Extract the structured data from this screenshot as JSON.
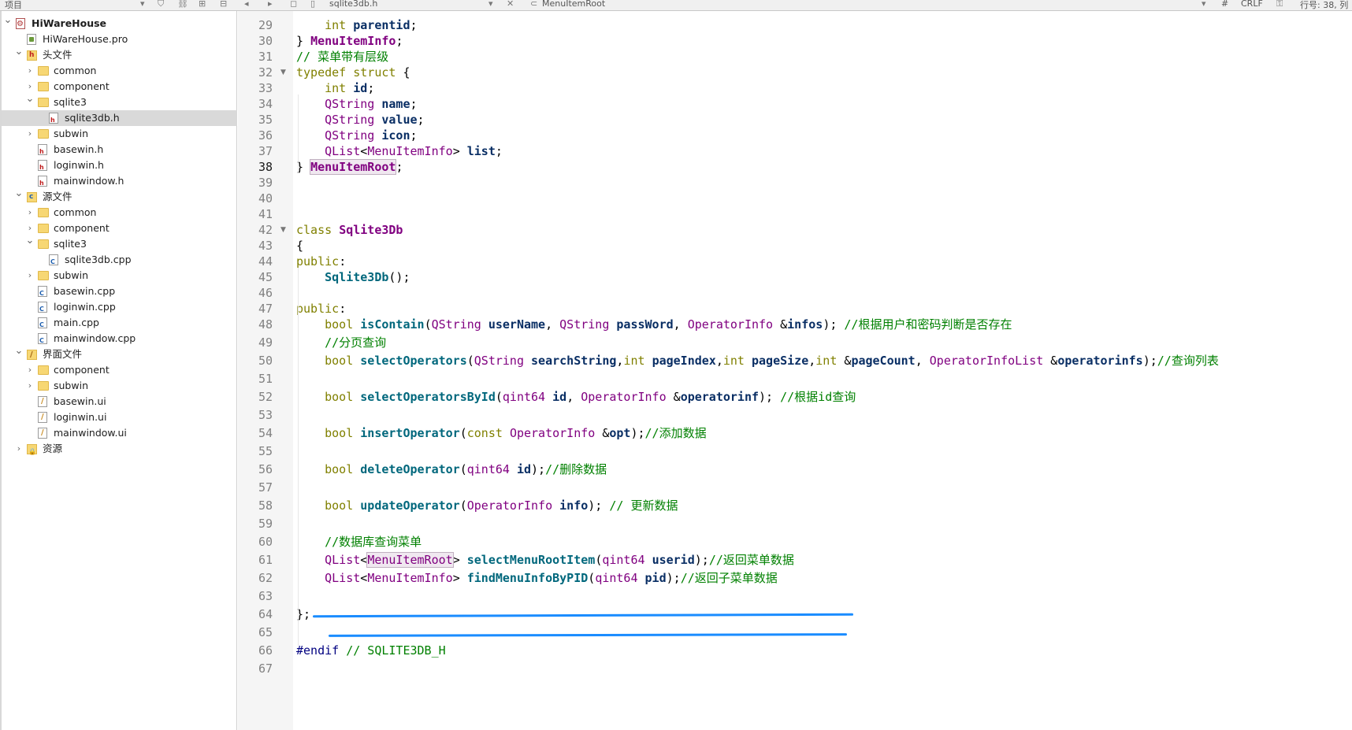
{
  "topbar": {
    "project_label": "项目",
    "file_tab": "sqlite3db.h",
    "symbol": "MenuItemRoot",
    "hash": "#",
    "line_ending": "CRLF",
    "position": "行号: 38, 列"
  },
  "tree": [
    {
      "label": "HiWareHouse",
      "icon": "project-icon",
      "level": 0,
      "arrow": "v",
      "bold": true
    },
    {
      "label": "HiWareHouse.pro",
      "icon": "pro-file-icon",
      "level": 1,
      "arrow": ""
    },
    {
      "label": "头文件",
      "icon": "headers-folder-icon",
      "level": 1,
      "arrow": "v"
    },
    {
      "label": "common",
      "icon": "folder-icon",
      "level": 2,
      "arrow": ">"
    },
    {
      "label": "component",
      "icon": "folder-icon",
      "level": 2,
      "arrow": ">"
    },
    {
      "label": "sqlite3",
      "icon": "folder-icon",
      "level": 2,
      "arrow": "v"
    },
    {
      "label": "sqlite3db.h",
      "icon": "header-file-icon",
      "level": 3,
      "arrow": "",
      "selected": true
    },
    {
      "label": "subwin",
      "icon": "folder-icon",
      "level": 2,
      "arrow": ">"
    },
    {
      "label": "basewin.h",
      "icon": "header-file-icon",
      "level": 2,
      "arrow": ""
    },
    {
      "label": "loginwin.h",
      "icon": "header-file-icon",
      "level": 2,
      "arrow": ""
    },
    {
      "label": "mainwindow.h",
      "icon": "header-file-icon",
      "level": 2,
      "arrow": ""
    },
    {
      "label": "源文件",
      "icon": "sources-folder-icon",
      "level": 1,
      "arrow": "v"
    },
    {
      "label": "common",
      "icon": "folder-icon",
      "level": 2,
      "arrow": ">"
    },
    {
      "label": "component",
      "icon": "folder-icon",
      "level": 2,
      "arrow": ">"
    },
    {
      "label": "sqlite3",
      "icon": "folder-icon",
      "level": 2,
      "arrow": "v"
    },
    {
      "label": "sqlite3db.cpp",
      "icon": "cpp-file-icon",
      "level": 3,
      "arrow": ""
    },
    {
      "label": "subwin",
      "icon": "folder-icon",
      "level": 2,
      "arrow": ">"
    },
    {
      "label": "basewin.cpp",
      "icon": "cpp-file-icon",
      "level": 2,
      "arrow": ""
    },
    {
      "label": "loginwin.cpp",
      "icon": "cpp-file-icon",
      "level": 2,
      "arrow": ""
    },
    {
      "label": "main.cpp",
      "icon": "cpp-file-icon",
      "level": 2,
      "arrow": ""
    },
    {
      "label": "mainwindow.cpp",
      "icon": "cpp-file-icon",
      "level": 2,
      "arrow": ""
    },
    {
      "label": "界面文件",
      "icon": "forms-folder-icon",
      "level": 1,
      "arrow": "v"
    },
    {
      "label": "component",
      "icon": "folder-icon",
      "level": 2,
      "arrow": ">"
    },
    {
      "label": "subwin",
      "icon": "folder-icon",
      "level": 2,
      "arrow": ">"
    },
    {
      "label": "basewin.ui",
      "icon": "ui-file-icon",
      "level": 2,
      "arrow": ""
    },
    {
      "label": "loginwin.ui",
      "icon": "ui-file-icon",
      "level": 2,
      "arrow": ""
    },
    {
      "label": "mainwindow.ui",
      "icon": "ui-file-icon",
      "level": 2,
      "arrow": ""
    },
    {
      "label": "资源",
      "icon": "resources-folder-icon",
      "level": 1,
      "arrow": ">"
    }
  ],
  "editor": {
    "current_line": 38,
    "lines": [
      {
        "n": "29",
        "tokens": [
          [
            "    ",
            ""
          ],
          [
            "int",
            "k"
          ],
          [
            " ",
            ""
          ],
          [
            "parentid",
            "b"
          ],
          [
            ";",
            ""
          ]
        ]
      },
      {
        "n": "30",
        "tokens": [
          [
            "} ",
            ""
          ],
          [
            "MenuItemInfo",
            "tb"
          ],
          [
            ";",
            ""
          ]
        ]
      },
      {
        "n": "31",
        "tokens": [
          [
            "// 菜单带有层级",
            "c"
          ]
        ]
      },
      {
        "n": "32",
        "fold": true,
        "tokens": [
          [
            "typedef",
            "k"
          ],
          [
            " ",
            ""
          ],
          [
            "struct",
            "k"
          ],
          [
            " {",
            ""
          ]
        ]
      },
      {
        "n": "33",
        "tokens": [
          [
            "    ",
            ""
          ],
          [
            "int",
            "k"
          ],
          [
            " ",
            ""
          ],
          [
            "id",
            "b"
          ],
          [
            ";",
            ""
          ]
        ]
      },
      {
        "n": "34",
        "tokens": [
          [
            "    ",
            ""
          ],
          [
            "QString",
            "t"
          ],
          [
            " ",
            ""
          ],
          [
            "name",
            "b"
          ],
          [
            ";",
            ""
          ]
        ]
      },
      {
        "n": "35",
        "tokens": [
          [
            "    ",
            ""
          ],
          [
            "QString",
            "t"
          ],
          [
            " ",
            ""
          ],
          [
            "value",
            "b"
          ],
          [
            ";",
            ""
          ]
        ]
      },
      {
        "n": "36",
        "tokens": [
          [
            "    ",
            ""
          ],
          [
            "QString",
            "t"
          ],
          [
            " ",
            ""
          ],
          [
            "icon",
            "b"
          ],
          [
            ";",
            ""
          ]
        ]
      },
      {
        "n": "37",
        "tokens": [
          [
            "    ",
            ""
          ],
          [
            "QList",
            "t"
          ],
          [
            "<",
            ""
          ],
          [
            "MenuItemInfo",
            "t"
          ],
          [
            "> ",
            ""
          ],
          [
            "list",
            "b"
          ],
          [
            ";",
            ""
          ]
        ]
      },
      {
        "n": "38",
        "tokens": [
          [
            "} ",
            ""
          ],
          [
            "MenuItemRoot",
            "tbh"
          ],
          [
            ";",
            ""
          ]
        ]
      },
      {
        "n": "39",
        "tokens": []
      },
      {
        "n": "40",
        "tokens": []
      },
      {
        "n": "41",
        "tokens": []
      },
      {
        "n": "42",
        "fold": true,
        "tokens": [
          [
            "class",
            "k"
          ],
          [
            " ",
            ""
          ],
          [
            "Sqlite3Db",
            "tb"
          ]
        ]
      },
      {
        "n": "43",
        "tokens": [
          [
            "{",
            ""
          ]
        ]
      },
      {
        "n": "44",
        "tokens": [
          [
            "public",
            "k"
          ],
          [
            ":",
            ""
          ]
        ]
      },
      {
        "n": "45",
        "tokens": [
          [
            "    ",
            ""
          ],
          [
            "Sqlite3Db",
            "mb"
          ],
          [
            "();",
            ""
          ]
        ]
      },
      {
        "n": "46",
        "tokens": []
      },
      {
        "n": "47",
        "tokens": [
          [
            "public",
            "k"
          ],
          [
            ":",
            ""
          ]
        ]
      },
      {
        "n": "48",
        "tokens": [
          [
            "    ",
            ""
          ],
          [
            "bool",
            "k"
          ],
          [
            " ",
            ""
          ],
          [
            "isContain",
            "mb"
          ],
          [
            "(",
            ""
          ],
          [
            "QString",
            "t"
          ],
          [
            " ",
            ""
          ],
          [
            "userName",
            "b"
          ],
          [
            ", ",
            ""
          ],
          [
            "QString",
            "t"
          ],
          [
            " ",
            ""
          ],
          [
            "passWord",
            "b"
          ],
          [
            ", ",
            ""
          ],
          [
            "OperatorInfo",
            "t"
          ],
          [
            " &",
            ""
          ],
          [
            "infos",
            "b"
          ],
          [
            "); ",
            ""
          ],
          [
            "//根据用户和密码判断是否存在",
            "c"
          ]
        ]
      },
      {
        "n": "49",
        "tokens": [
          [
            "    ",
            ""
          ],
          [
            "//分页查询",
            "c"
          ]
        ]
      },
      {
        "n": "50",
        "tokens": [
          [
            "    ",
            ""
          ],
          [
            "bool",
            "k"
          ],
          [
            " ",
            ""
          ],
          [
            "selectOperators",
            "mb"
          ],
          [
            "(",
            ""
          ],
          [
            "QString",
            "t"
          ],
          [
            " ",
            ""
          ],
          [
            "searchString",
            "b"
          ],
          [
            ",",
            ""
          ],
          [
            "int",
            "k"
          ],
          [
            " ",
            ""
          ],
          [
            "pageIndex",
            "b"
          ],
          [
            ",",
            ""
          ],
          [
            "int",
            "k"
          ],
          [
            " ",
            ""
          ],
          [
            "pageSize",
            "b"
          ],
          [
            ",",
            ""
          ],
          [
            "int",
            "k"
          ],
          [
            " &",
            ""
          ],
          [
            "pageCount",
            "b"
          ],
          [
            ", ",
            ""
          ],
          [
            "OperatorInfoList",
            "t"
          ],
          [
            " &",
            ""
          ],
          [
            "operatorinfs",
            "b"
          ],
          [
            ");",
            ""
          ],
          [
            "//查询列表",
            "c"
          ]
        ]
      },
      {
        "n": "51",
        "tokens": []
      },
      {
        "n": "52",
        "tokens": [
          [
            "    ",
            ""
          ],
          [
            "bool",
            "k"
          ],
          [
            " ",
            ""
          ],
          [
            "selectOperatorsById",
            "mb"
          ],
          [
            "(",
            ""
          ],
          [
            "qint64",
            "t"
          ],
          [
            " ",
            ""
          ],
          [
            "id",
            "b"
          ],
          [
            ", ",
            ""
          ],
          [
            "OperatorInfo",
            "t"
          ],
          [
            " &",
            ""
          ],
          [
            "operatorinf",
            "b"
          ],
          [
            "); ",
            ""
          ],
          [
            "//根据id查询",
            "c"
          ]
        ]
      },
      {
        "n": "53",
        "tokens": []
      },
      {
        "n": "54",
        "tokens": [
          [
            "    ",
            ""
          ],
          [
            "bool",
            "k"
          ],
          [
            " ",
            ""
          ],
          [
            "insertOperator",
            "mb"
          ],
          [
            "(",
            ""
          ],
          [
            "const",
            "k"
          ],
          [
            " ",
            ""
          ],
          [
            "OperatorInfo",
            "t"
          ],
          [
            " &",
            ""
          ],
          [
            "opt",
            "b"
          ],
          [
            ");",
            ""
          ],
          [
            "//添加数据",
            "c"
          ]
        ]
      },
      {
        "n": "55",
        "tokens": []
      },
      {
        "n": "56",
        "tokens": [
          [
            "    ",
            ""
          ],
          [
            "bool",
            "k"
          ],
          [
            " ",
            ""
          ],
          [
            "deleteOperator",
            "mb"
          ],
          [
            "(",
            ""
          ],
          [
            "qint64",
            "t"
          ],
          [
            " ",
            ""
          ],
          [
            "id",
            "b"
          ],
          [
            ");",
            ""
          ],
          [
            "//删除数据",
            "c"
          ]
        ]
      },
      {
        "n": "57",
        "tokens": []
      },
      {
        "n": "58",
        "tokens": [
          [
            "    ",
            ""
          ],
          [
            "bool",
            "k"
          ],
          [
            " ",
            ""
          ],
          [
            "updateOperator",
            "mb"
          ],
          [
            "(",
            ""
          ],
          [
            "OperatorInfo",
            "t"
          ],
          [
            " ",
            ""
          ],
          [
            "info",
            "b"
          ],
          [
            "); ",
            ""
          ],
          [
            "// 更新数据",
            "c"
          ]
        ]
      },
      {
        "n": "59",
        "tokens": []
      },
      {
        "n": "60",
        "tokens": [
          [
            "    ",
            ""
          ],
          [
            "//数据库查询菜单",
            "c"
          ]
        ]
      },
      {
        "n": "61",
        "tokens": [
          [
            "    ",
            ""
          ],
          [
            "QList",
            "t"
          ],
          [
            "<",
            ""
          ],
          [
            "MenuItemRoot",
            "th"
          ],
          [
            "> ",
            ""
          ],
          [
            "selectMenuRootItem",
            "mb"
          ],
          [
            "(",
            ""
          ],
          [
            "qint64",
            "t"
          ],
          [
            " ",
            ""
          ],
          [
            "userid",
            "b"
          ],
          [
            ");",
            ""
          ],
          [
            "//返回菜单数据",
            "c"
          ]
        ]
      },
      {
        "n": "62",
        "tokens": [
          [
            "    ",
            ""
          ],
          [
            "QList",
            "t"
          ],
          [
            "<",
            ""
          ],
          [
            "MenuItemInfo",
            "t"
          ],
          [
            "> ",
            ""
          ],
          [
            "findMenuInfoByPID",
            "mb"
          ],
          [
            "(",
            ""
          ],
          [
            "qint64",
            "t"
          ],
          [
            " ",
            ""
          ],
          [
            "pid",
            "b"
          ],
          [
            ");",
            ""
          ],
          [
            "//返回子菜单数据",
            "c"
          ]
        ]
      },
      {
        "n": "63",
        "tokens": []
      },
      {
        "n": "64",
        "tokens": [
          [
            "};",
            ""
          ]
        ]
      },
      {
        "n": "65",
        "tokens": []
      },
      {
        "n": "66",
        "tokens": [
          [
            "#endif",
            "m"
          ],
          [
            " ",
            ""
          ],
          [
            "// SQLITE3DB_H",
            "c"
          ]
        ]
      },
      {
        "n": "67",
        "tokens": []
      }
    ]
  },
  "colors": {
    "keyword": "#808000",
    "type": "#800080",
    "comment": "#008000",
    "annotation_underline": "#1a8cff"
  }
}
